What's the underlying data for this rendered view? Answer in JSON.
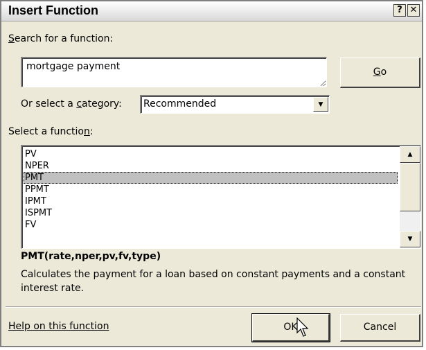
{
  "window": {
    "title": "Insert Function",
    "help_icon": "question-icon",
    "close_icon": "close-icon"
  },
  "search": {
    "label_prefix": "",
    "label_accel": "S",
    "label_rest": "earch for a function:",
    "value": "mortgage payment",
    "go_prefix": "",
    "go_accel": "G",
    "go_rest": "o"
  },
  "category": {
    "label_prefix": "Or select a ",
    "label_accel": "c",
    "label_rest": "ategory:",
    "selected": "Recommended"
  },
  "functions": {
    "label_prefix": "Select a functio",
    "label_accel": "n",
    "label_rest": ":",
    "items": [
      "PV",
      "NPER",
      "PMT",
      "PPMT",
      "IPMT",
      "ISPMT",
      "FV"
    ],
    "selected": "PMT"
  },
  "details": {
    "signature": "PMT(rate,nper,pv,fv,type)",
    "description": "Calculates the payment for a loan based on constant payments and a constant interest rate."
  },
  "footer": {
    "help_link": "Help on this function",
    "ok_label": "OK",
    "cancel_label": "Cancel"
  },
  "colors": {
    "dialog_bg": "#ece9d8",
    "selection_bg": "#c0c0c0"
  }
}
